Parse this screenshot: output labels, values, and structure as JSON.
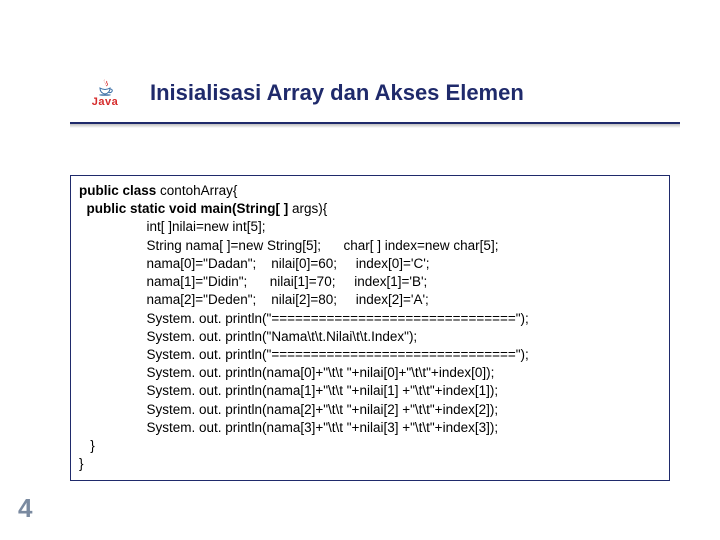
{
  "logo": {
    "wordmark": "Java"
  },
  "title": "Inisialisasi Array dan Akses Elemen",
  "code": {
    "l01a": "public class ",
    "l01b": "contohArray{",
    "l02a": "  public static void main(String[ ] ",
    "l02b": "args){",
    "l03": "                  int[ ]nilai=new int[5];",
    "l04": "                  String nama[ ]=new String[5];      char[ ] index=new char[5];",
    "l05": "                  nama[0]=\"Dadan\";    nilai[0]=60;     index[0]='C';",
    "l06": "                  nama[1]=\"Didin\";      nilai[1]=70;     index[1]='B';",
    "l07": "                  nama[2]=\"Deden\";    nilai[2]=80;     index[2]='A';",
    "l08": "                  System. out. println(\"===============================\");",
    "l09": "                  System. out. println(\"Nama\\t\\t.Nilai\\t\\t.Index\");",
    "l10": "                  System. out. println(\"===============================\");",
    "l11": "                  System. out. println(nama[0]+\"\\t\\t \"+nilai[0]+\"\\t\\t\"+index[0]);",
    "l12": "                  System. out. println(nama[1]+\"\\t\\t \"+nilai[1] +\"\\t\\t\"+index[1]);",
    "l13": "                  System. out. println(nama[2]+\"\\t\\t \"+nilai[2] +\"\\t\\t\"+index[2]);",
    "l14": "                  System. out. println(nama[3]+\"\\t\\t \"+nilai[3] +\"\\t\\t\"+index[3]);",
    "l15": "   }",
    "l16": "}"
  },
  "slide_number": "4"
}
